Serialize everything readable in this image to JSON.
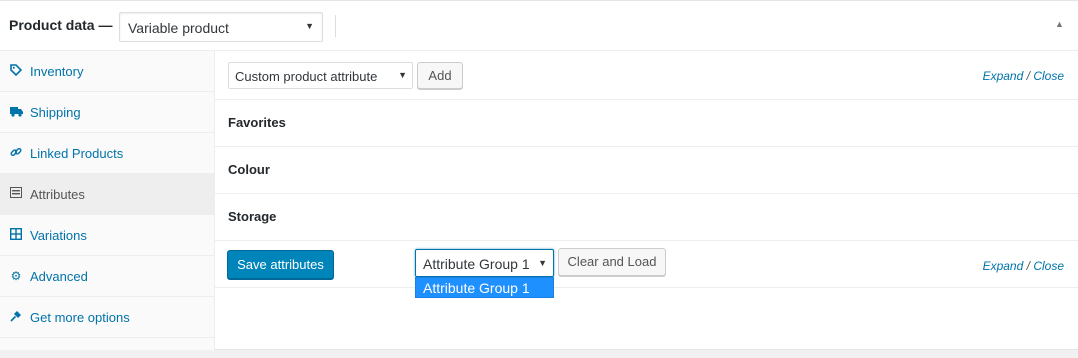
{
  "header": {
    "title": "Product data —",
    "product_type": "Variable product"
  },
  "sidebar": {
    "items": [
      {
        "label": "Inventory",
        "icon": "tag-icon"
      },
      {
        "label": "Shipping",
        "icon": "truck-icon"
      },
      {
        "label": "Linked Products",
        "icon": "link-icon"
      },
      {
        "label": "Attributes",
        "icon": "list-icon",
        "active": true
      },
      {
        "label": "Variations",
        "icon": "grid-icon"
      },
      {
        "label": "Advanced",
        "icon": "gear-icon"
      },
      {
        "label": "Get more options",
        "icon": "plug-icon"
      }
    ]
  },
  "toolbar": {
    "attribute_select": "Custom product attribute",
    "add_label": "Add",
    "expand": "Expand",
    "separator": "/",
    "close": "Close"
  },
  "attributes": [
    {
      "name": "Favorites"
    },
    {
      "name": "Colour"
    },
    {
      "name": "Storage"
    }
  ],
  "footer": {
    "save_label": "Save attributes",
    "group_select": "Attribute Group 1",
    "clear_load_label": "Clear and Load",
    "expand": "Expand",
    "separator": "/",
    "close": "Close"
  },
  "dropdown": {
    "options": [
      "Attribute Group 1"
    ]
  },
  "colors": {
    "link": "#0073aa",
    "primary_button": "#0085ba",
    "dropdown_highlight": "#1e90ff"
  }
}
